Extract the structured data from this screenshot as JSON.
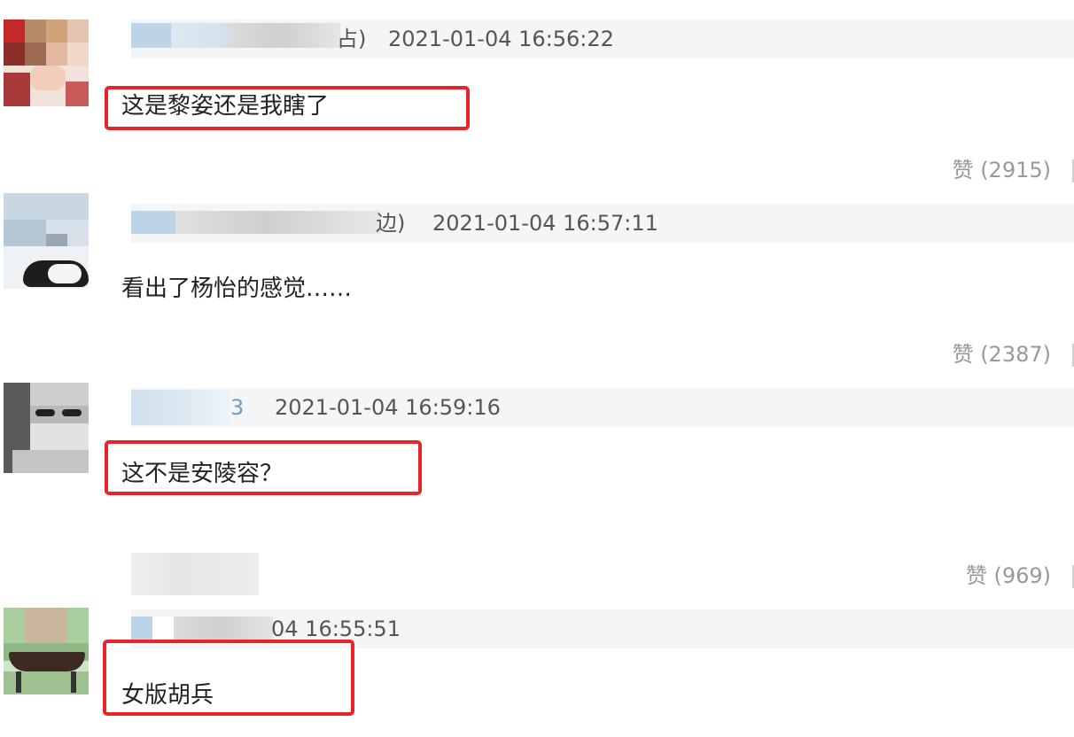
{
  "comments": [
    {
      "user_suffix": "占)",
      "timestamp": "2021-01-04 16:56:22",
      "text": "这是黎姿还是我瞎了",
      "likes": "赞 (2915)",
      "highlighted": true
    },
    {
      "user_suffix": "边)",
      "timestamp": "2021-01-04 16:57:11",
      "text": "看出了杨怡的感觉……",
      "likes": "赞 (2387)",
      "highlighted": false
    },
    {
      "user_suffix": "3",
      "timestamp": "2021-01-04 16:59:16",
      "text": "这不是安陵容？",
      "likes": "赞 (969)",
      "highlighted": true
    },
    {
      "user_suffix": "",
      "timestamp": "04 16:55:51",
      "text": "女版胡兵",
      "highlighted": true
    }
  ],
  "colors": {
    "highlight": "#e8232a",
    "meta_bar": "#f3f5f7",
    "blur_blue": "#bcd4e6",
    "blur_gray": "#d6d6d6"
  },
  "icons": [
    "avatar-image",
    "blurred-username"
  ]
}
